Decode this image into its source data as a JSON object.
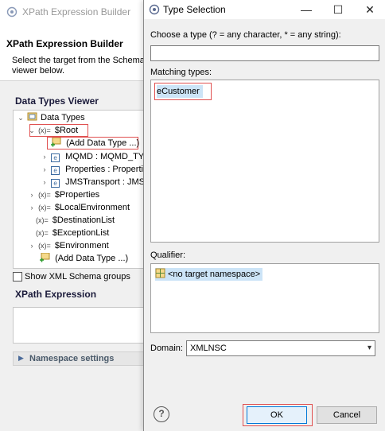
{
  "background_window": {
    "title": "XPath Expression Builder",
    "header_title": "XPath Expression Builder",
    "header_desc": "Select the target from the Schema viewer below.",
    "data_types_viewer_title": "Data Types Viewer",
    "tree": {
      "root_label": "Data Types",
      "items": [
        {
          "prefix": "(x)=",
          "label": "$Root"
        },
        {
          "label": "(Add Data Type ...)"
        },
        {
          "label": "MQMD : MQMD_TY"
        },
        {
          "label": "Properties : Propertie"
        },
        {
          "label": "JMSTransport : JMST"
        },
        {
          "prefix": "(x)=",
          "label": "$Properties"
        },
        {
          "prefix": "(x)=",
          "label": "$LocalEnvironment"
        },
        {
          "prefix": "(x)=",
          "label": "$DestinationList"
        },
        {
          "prefix": "(x)=",
          "label": "$ExceptionList"
        },
        {
          "prefix": "(x)=",
          "label": "$Environment"
        },
        {
          "label": "(Add Data Type ...)"
        }
      ]
    },
    "show_xml_schema_groups": "Show XML Schema groups",
    "xpath_expression_title": "XPath Expression",
    "namespace_settings": "Namespace settings"
  },
  "dialog": {
    "title": "Type Selection",
    "minimize": "—",
    "maximize": "☐",
    "close": "✕",
    "filter_label": "Choose a type (? = any character, * = any string):",
    "filter_value": "",
    "matching_label": "Matching types:",
    "matching_types": [
      "Customer"
    ],
    "qualifier_label": "Qualifier:",
    "qualifier_items": [
      "<no target namespace>"
    ],
    "domain_label": "Domain:",
    "domain_value": "XMLNSC",
    "help": "?",
    "ok_label": "OK",
    "cancel_label": "Cancel"
  },
  "colors": {
    "highlight": "#e05050",
    "selection": "#cce4f7",
    "primary_border": "#0078d7"
  }
}
